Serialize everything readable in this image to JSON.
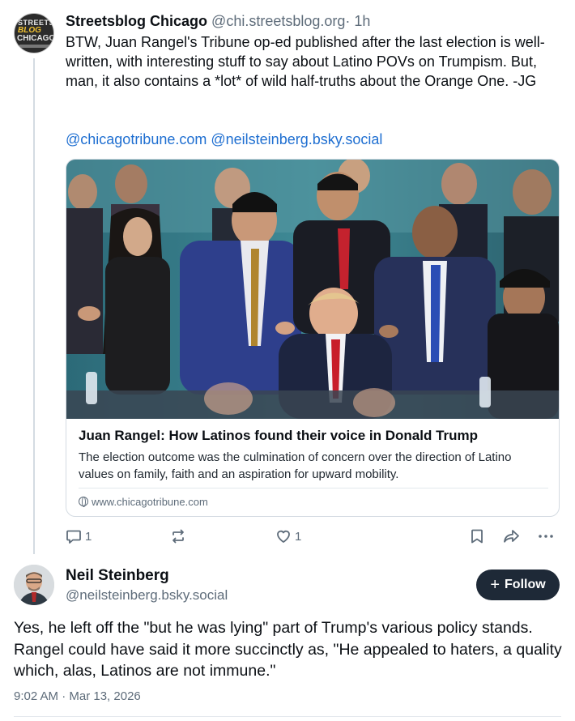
{
  "parent_post": {
    "avatar_text": [
      "STREETS",
      "BLOG",
      "CHICAGO"
    ],
    "author_name": "Streetsblog Chicago",
    "author_handle": "@chi.streetsblog.org",
    "separator": "·",
    "time_ago": "1h",
    "text": "BTW, Juan Rangel's Tribune op-ed published after the last election is well-written, with interesting stuff to say about Latino POVs on Trumpism. But, man, it also contains a *lot* of wild half-truths about the Orange One. -JG",
    "mentions": [
      "@chicagotribune.com",
      "@neilsteinberg.bsky.social"
    ],
    "link_card": {
      "image_icon": "photo-prayer-group",
      "title": "Juan Rangel: How Latinos found their voice in Donald Trump",
      "description": "The election outcome was the culmination of concern over the direction of Latino values on family, faith and an aspiration for upward mobility.",
      "url": "www.chicagotribune.com"
    },
    "actions": {
      "reply_count": "1",
      "repost_count": "",
      "like_count": "1"
    }
  },
  "main_post": {
    "author_name": "Neil Steinberg",
    "author_handle": "@neilsteinberg.bsky.social",
    "follow_label": "Follow",
    "text": "Yes, he left off the \"but he was lying\" part of Trump's various policy stands. Rangel could have said it more succinctly as, \"He appealed to haters, a quality which, alas, Latinos are not immune.\"",
    "timestamp": "9:02 AM · Mar 13, 2026"
  },
  "colors": {
    "link": "#1f6fd1",
    "muted": "#5e6c7a",
    "follow_button_bg": "#1e2937",
    "border": "#d4dbe2"
  }
}
